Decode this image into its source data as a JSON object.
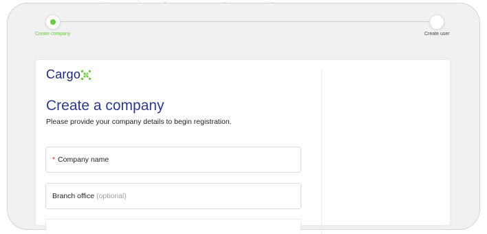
{
  "stepper": {
    "steps": [
      {
        "label": "Create company",
        "state": "active"
      },
      {
        "label": "Create user",
        "state": "pending"
      }
    ],
    "active_color": "#6ccb3a"
  },
  "brand": {
    "logo_text": "Cargo",
    "logo_mark": "X",
    "logo_icon": "cargox-x-icon",
    "primary_color": "#2b3a8c"
  },
  "form": {
    "title": "Create a company",
    "subtitle": "Please provide your company details to begin registration.",
    "fields": [
      {
        "label": "Company name",
        "required": true,
        "required_mark": "*",
        "value": ""
      },
      {
        "label": "Branch office",
        "optional_label": "(optional)",
        "required": false,
        "value": ""
      }
    ]
  }
}
